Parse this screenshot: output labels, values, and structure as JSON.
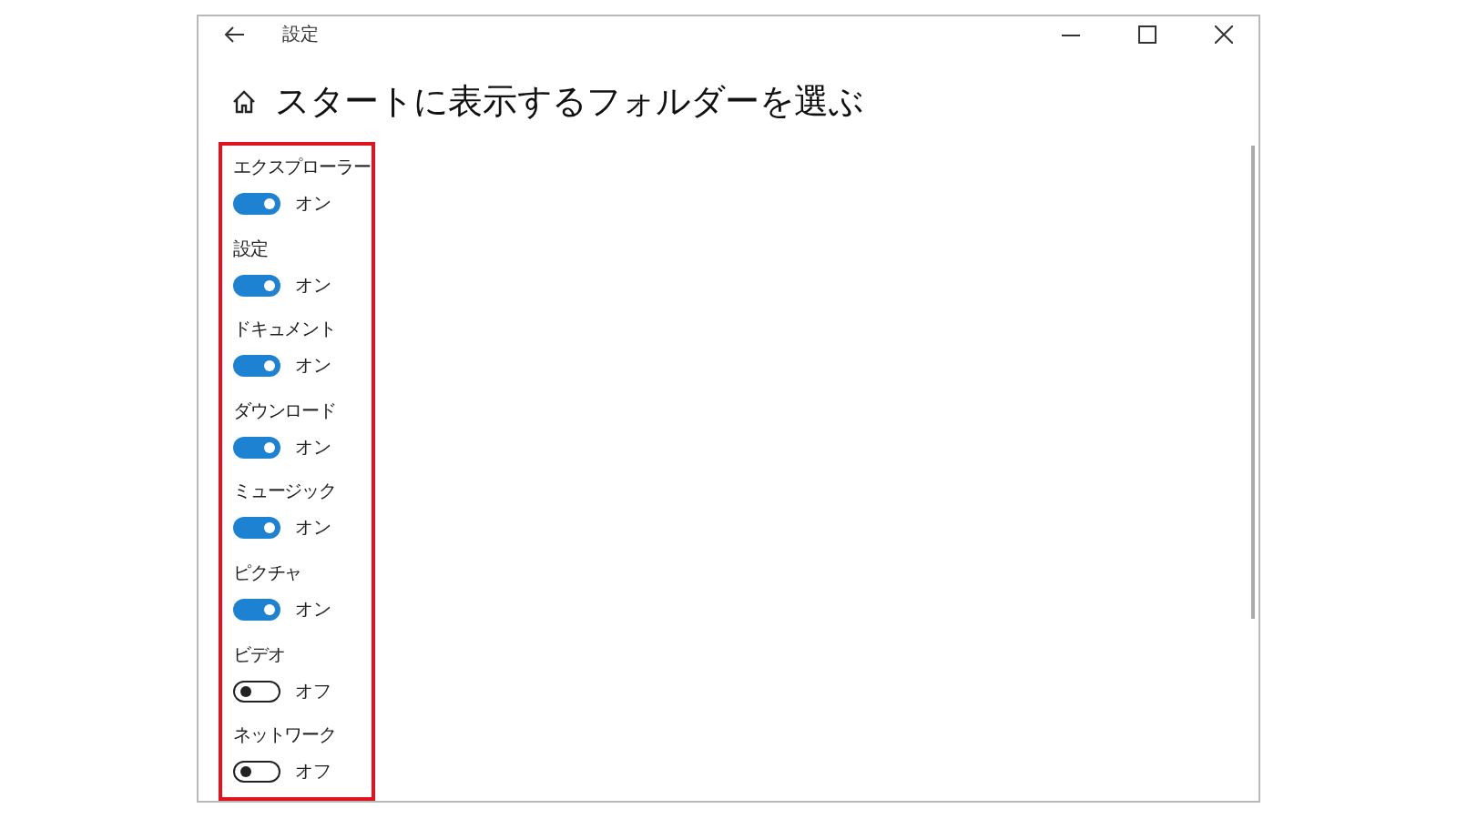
{
  "window": {
    "title": "設定"
  },
  "page": {
    "title": "スタートに表示するフォルダーを選ぶ"
  },
  "folders": [
    {
      "name": "エクスプローラー",
      "on": true,
      "state_label": "オン"
    },
    {
      "name": "設定",
      "on": true,
      "state_label": "オン"
    },
    {
      "name": "ドキュメント",
      "on": true,
      "state_label": "オン"
    },
    {
      "name": "ダウンロード",
      "on": true,
      "state_label": "オン"
    },
    {
      "name": "ミュージック",
      "on": true,
      "state_label": "オン"
    },
    {
      "name": "ピクチャ",
      "on": true,
      "state_label": "オン"
    },
    {
      "name": "ビデオ",
      "on": false,
      "state_label": "オフ"
    },
    {
      "name": "ネットワーク",
      "on": false,
      "state_label": "オフ"
    }
  ]
}
